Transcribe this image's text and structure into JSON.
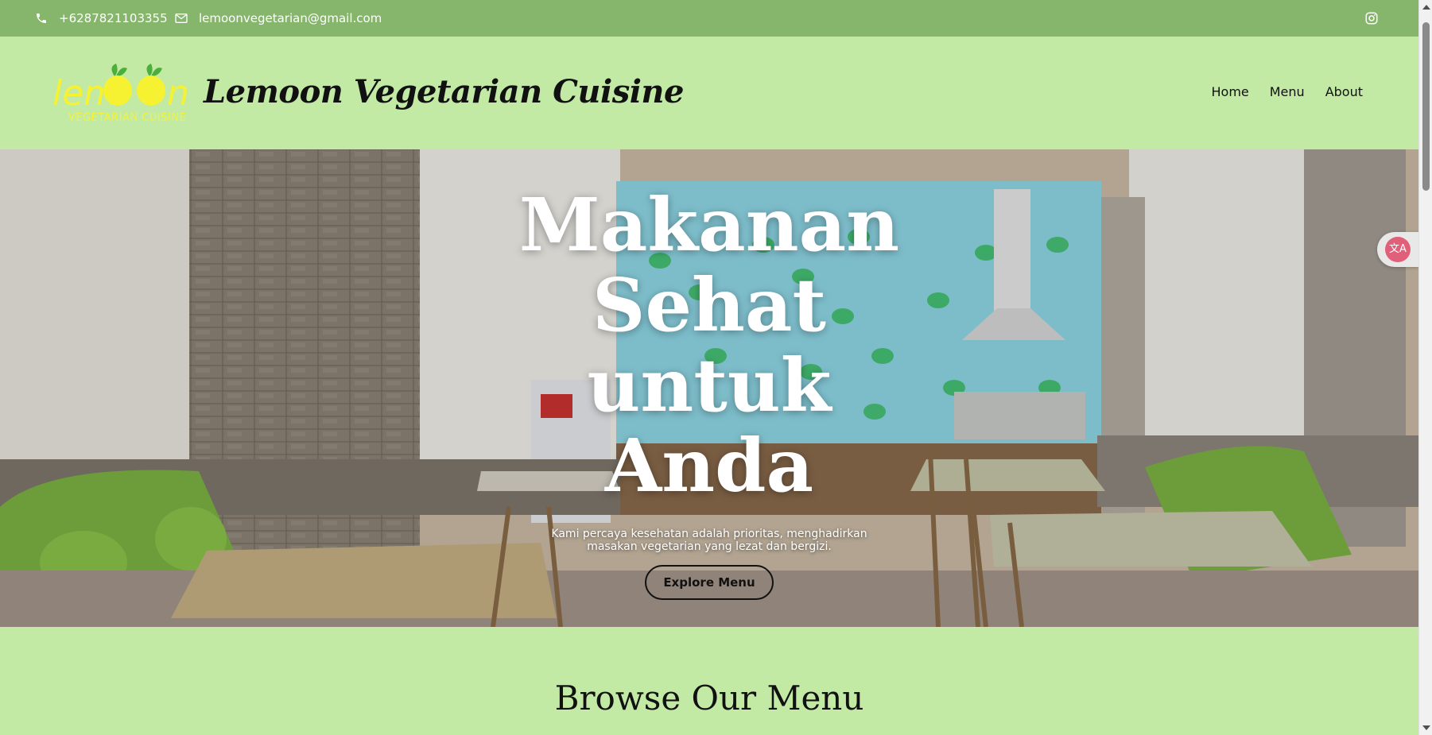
{
  "topbar": {
    "phone": "+6287821103355",
    "email": "lemoonvegetarian@gmail.com",
    "icons": {
      "phone": "phone-icon",
      "email": "envelope-icon",
      "social": "instagram-icon"
    }
  },
  "header": {
    "logo": {
      "word": "lemoon",
      "tagline": "VEGETARIAN CUISINE"
    },
    "brand_title": "Lemoon Vegetarian Cuisine",
    "nav": [
      "Home",
      "Menu",
      "About"
    ]
  },
  "hero": {
    "title_lines": [
      "Makanan",
      "Sehat",
      "untuk",
      "Anda"
    ],
    "subtitle": "Kami percaya kesehatan adalah prioritas, menghadirkan masakan vegetarian yang lezat dan bergizi.",
    "button": "Explore Menu"
  },
  "browse": {
    "heading": "Browse Our Menu"
  },
  "widgets": {
    "translate_icon": "translate-icon",
    "translate_glyph": "文A"
  },
  "colors": {
    "topbar": "#86b56c",
    "header_bg": "#c2eaa5",
    "logo_yellow": "#f6f232",
    "logo_leaf": "#4caf3a"
  }
}
